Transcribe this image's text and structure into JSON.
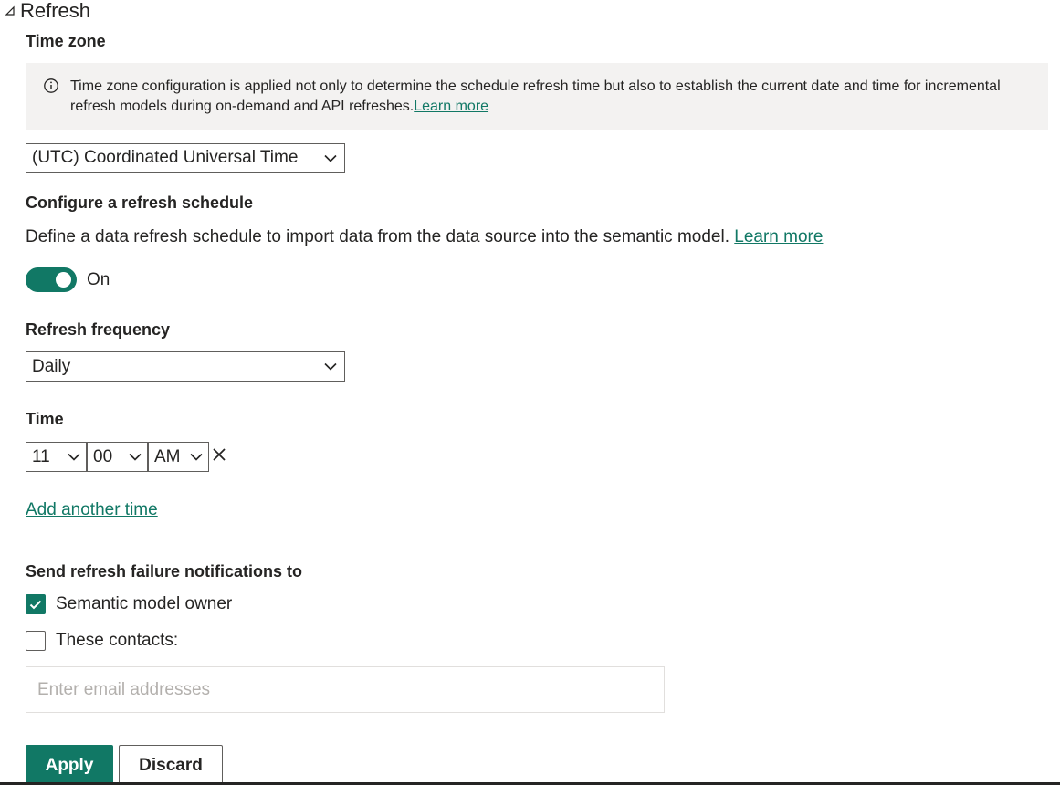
{
  "section": {
    "title": "Refresh",
    "collapse_icon": "triangle-collapse-icon"
  },
  "time_zone": {
    "label": "Time zone",
    "info_icon": "info-circle-icon",
    "info_text": "Time zone configuration is applied not only to determine the schedule refresh time but also to establish the current date and time for incremental refresh models during on-demand and API refreshes.",
    "info_link": "Learn more",
    "selected": "(UTC) Coordinated Universal Time"
  },
  "schedule": {
    "label": "Configure a refresh schedule",
    "description": "Define a data refresh schedule to import data from the data source into the semantic model.",
    "learn_more": "Learn more",
    "toggle_label": "On",
    "toggle_on": true
  },
  "frequency": {
    "label": "Refresh frequency",
    "selected": "Daily"
  },
  "time": {
    "label": "Time",
    "hour": "11",
    "minute": "00",
    "period": "AM",
    "remove_icon": "close-x-icon",
    "add_another": "Add another time"
  },
  "notifications": {
    "label": "Send refresh failure notifications to",
    "owner_label": "Semantic model owner",
    "owner_checked": true,
    "contacts_label": "These contacts:",
    "contacts_checked": false,
    "email_placeholder": "Enter email addresses",
    "email_value": ""
  },
  "actions": {
    "apply": "Apply",
    "discard": "Discard"
  },
  "colors": {
    "accent": "#117865",
    "text": "#252423",
    "info_bg": "#f3f2f1",
    "border": "#605e5c"
  }
}
